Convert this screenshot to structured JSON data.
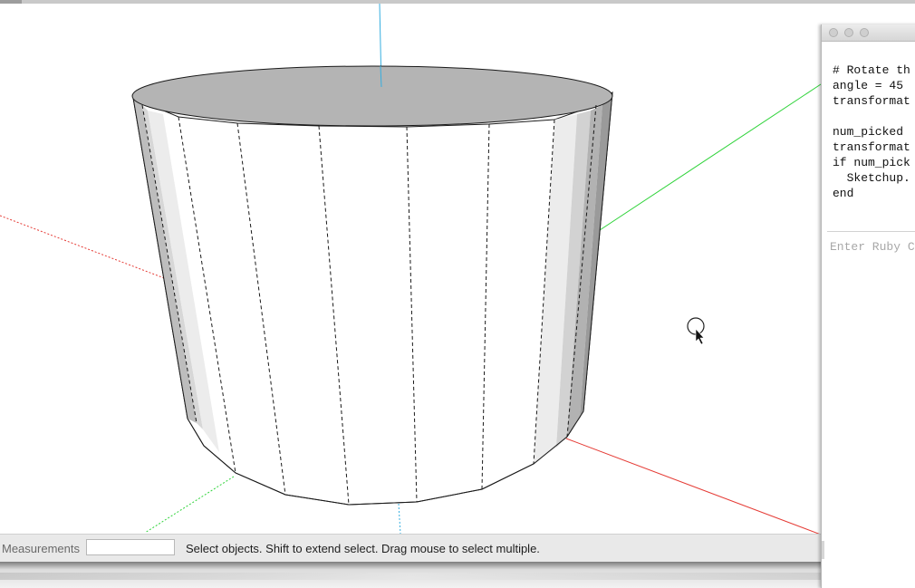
{
  "statusbar": {
    "measurements_label": "Measurements",
    "measurements_value": "",
    "status_text": "Select objects. Shift to extend select. Drag mouse to select multiple."
  },
  "ruby_console": {
    "code_lines": [
      "# Rotate th",
      "angle = 45",
      "transformat",
      "",
      "num_picked",
      "transformat",
      "if num_pick",
      "  Sketchup.",
      "end"
    ],
    "input_placeholder": "Enter Ruby C"
  },
  "colors": {
    "axis_red": "#e53b35",
    "axis_green": "#2fd33a",
    "axis_blue": "#35aee0",
    "top_face": "#b4b4b4",
    "statusbar_bg": "#e9e9e9"
  },
  "icons": {
    "cursor": "select-arrow-cursor-icon"
  }
}
